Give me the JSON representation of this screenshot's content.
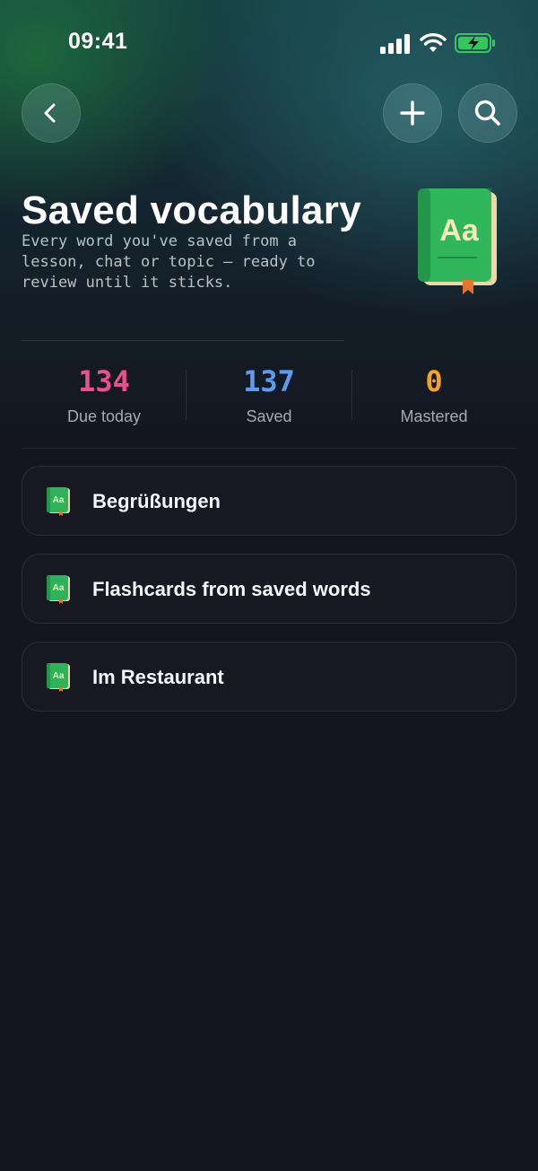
{
  "status_bar": {
    "time": "09:41",
    "icons": [
      "cellular-signal-icon",
      "wifi-icon",
      "battery-charging-icon"
    ]
  },
  "nav": {
    "icons": [
      "chevron-left-icon",
      "plus-icon",
      "search-icon"
    ]
  },
  "header": {
    "title": "Saved vocabulary",
    "subtitle": "Every word you've saved from a lesson, chat or topic — ready to review until it sticks.",
    "illustration_icon": "vocabulary-book-icon",
    "illustration_text": "Aa"
  },
  "stats": [
    {
      "value": "134",
      "label": "Due today",
      "color": "#ec4f91"
    },
    {
      "value": "137",
      "label": "Saved",
      "color": "#5b9cf0"
    },
    {
      "value": "0",
      "label": "Mastered",
      "color": "#f2a51c"
    }
  ],
  "lists": [
    {
      "label": "Begrüßungen",
      "icon": "vocabulary-book-icon"
    },
    {
      "label": "Flashcards from saved words",
      "icon": "vocabulary-book-icon"
    },
    {
      "label": "Im Restaurant",
      "icon": "vocabulary-book-icon"
    }
  ],
  "colors": {
    "background": "#14151f",
    "book_green": "#2fb35a",
    "bookmark_orange": "#e8742a",
    "battery_green": "#34c759"
  }
}
